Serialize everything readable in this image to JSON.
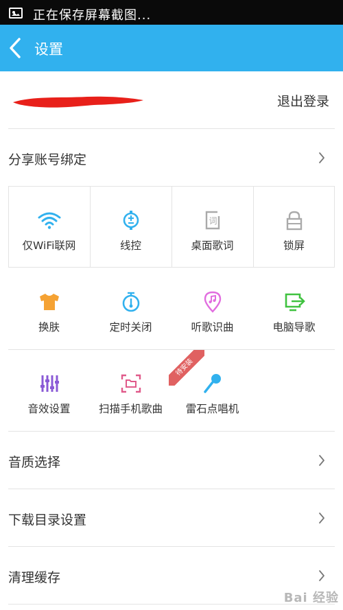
{
  "status_bar": {
    "notification_text": "正在保存屏幕截图..."
  },
  "header": {
    "back_icon": "chevron-left-icon",
    "title": "设置",
    "background_color": "#31b1ee"
  },
  "account": {
    "logout_label": "退出登录"
  },
  "share_binding": {
    "label": "分享账号绑定"
  },
  "feature_grid": [
    {
      "label": "仅WiFi联网",
      "icon": "wifi-icon",
      "color": "#31b1ee"
    },
    {
      "label": "线控",
      "icon": "wire-control-icon",
      "color": "#31b1ee"
    },
    {
      "label": "桌面歌词",
      "icon": "desktop-lyrics-icon",
      "color": "#aaaaaa"
    },
    {
      "label": "锁屏",
      "icon": "lock-icon",
      "color": "#aaaaaa"
    },
    {
      "label": "换肤",
      "icon": "shirt-icon",
      "color": "#f5a233"
    },
    {
      "label": "定时关闭",
      "icon": "timer-icon",
      "color": "#31b1ee"
    },
    {
      "label": "听歌识曲",
      "icon": "music-pin-icon",
      "color": "#e16ddf"
    },
    {
      "label": "电脑导歌",
      "icon": "pc-import-icon",
      "color": "#3fc23f"
    },
    {
      "label": "音效设置",
      "icon": "equalizer-icon",
      "color": "#8a5ad6"
    },
    {
      "label": "扫描手机歌曲",
      "icon": "scan-folder-icon",
      "color": "#e05a8a"
    },
    {
      "label": "雷石点唱机",
      "icon": "microphone-icon",
      "color": "#31b1ee"
    }
  ],
  "ribbon": {
    "label": "待安装"
  },
  "settings_list": [
    {
      "label": "音质选择"
    },
    {
      "label": "下载目录设置"
    },
    {
      "label": "清理缓存"
    }
  ],
  "watermark": {
    "text": "Bai 经验"
  }
}
